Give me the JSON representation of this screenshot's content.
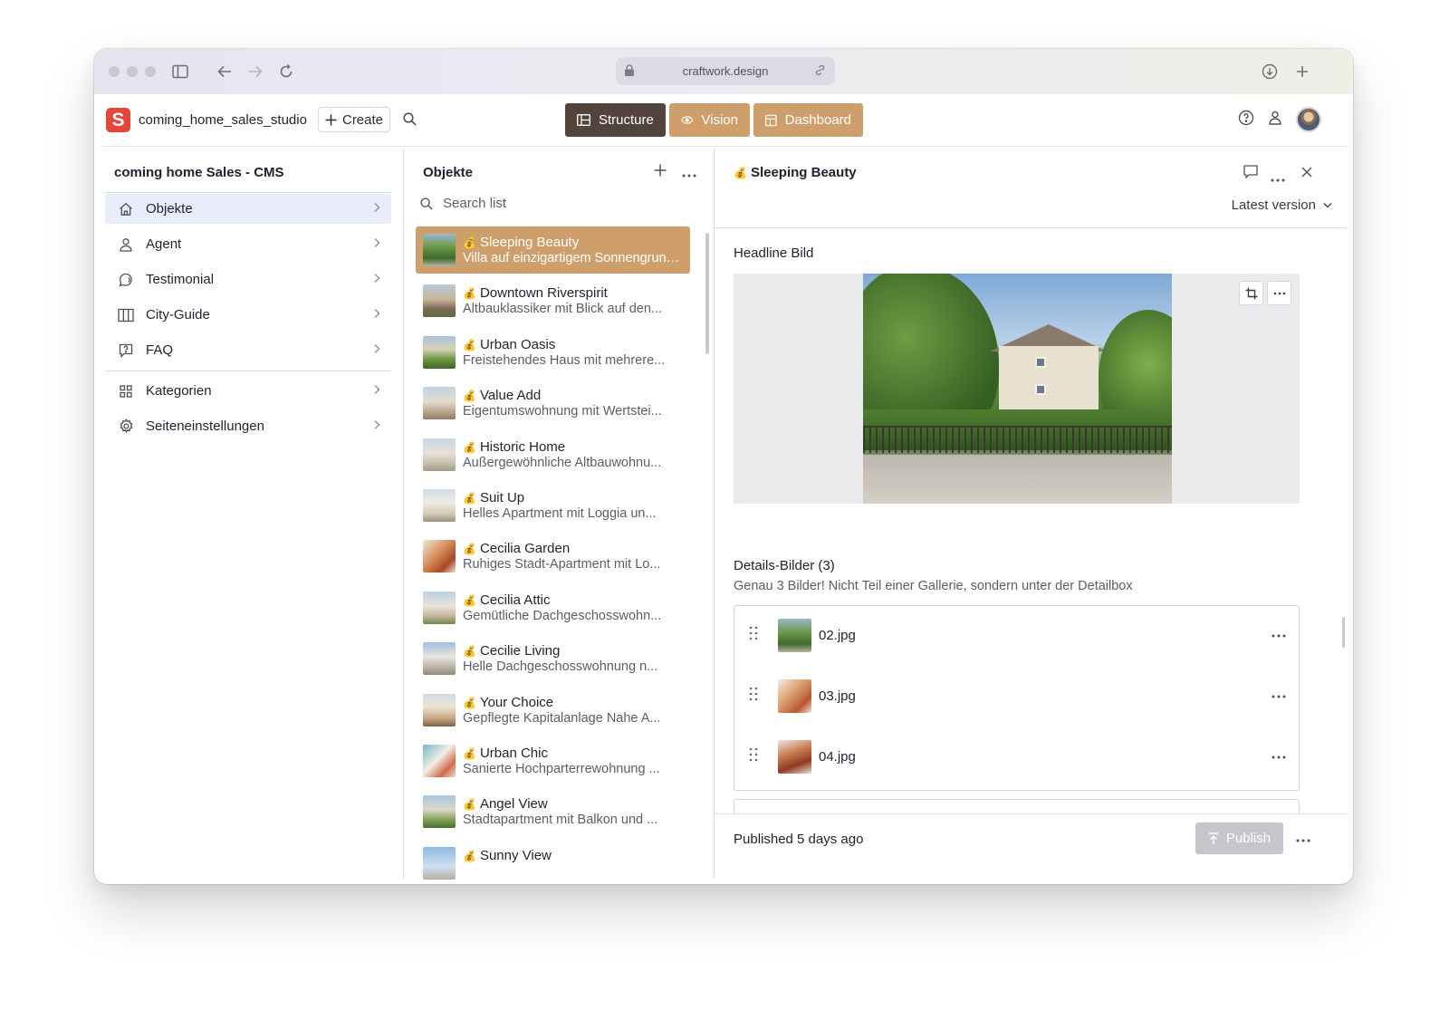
{
  "browser": {
    "url": "craftwork.design"
  },
  "topbar": {
    "logo_letter": "S",
    "workspace": "coming_home_sales_studio",
    "create_label": "Create",
    "tools": [
      {
        "label": "Structure"
      },
      {
        "label": "Vision"
      },
      {
        "label": "Dashboard"
      }
    ],
    "colors": {
      "structure": "#52443a",
      "tool": "#cf9f6b"
    }
  },
  "sidebar": {
    "title": "coming home Sales - CMS",
    "items": [
      {
        "label": "Objekte",
        "icon": "home-icon",
        "active": true
      },
      {
        "label": "Agent",
        "icon": "user-icon"
      },
      {
        "label": "Testimonial",
        "icon": "chat-icon"
      },
      {
        "label": "City-Guide",
        "icon": "map-icon"
      },
      {
        "label": "FAQ",
        "icon": "help-box-icon"
      }
    ],
    "items2": [
      {
        "label": "Kategorien",
        "icon": "grid-icon"
      },
      {
        "label": "Seiteneinstellungen",
        "icon": "gear-icon"
      }
    ]
  },
  "list": {
    "title": "Objekte",
    "search_placeholder": "Search list",
    "items": [
      {
        "title": "Sleeping Beauty",
        "subtitle": "Villa auf einzigartigem Sonnengrundstück",
        "active": true
      },
      {
        "title": "Downtown Riverspirit",
        "subtitle": "Altbauklassiker mit Blick auf den..."
      },
      {
        "title": "Urban Oasis",
        "subtitle": "Freistehendes Haus mit mehrere..."
      },
      {
        "title": "Value Add",
        "subtitle": "Eigentumswohnung mit Wertstei..."
      },
      {
        "title": "Historic Home",
        "subtitle": "Außergewöhnliche Altbauwohnu..."
      },
      {
        "title": "Suit Up",
        "subtitle": "Helles Apartment mit Loggia un..."
      },
      {
        "title": "Cecilia Garden",
        "subtitle": "Ruhiges Stadt-Apartment mit Lo..."
      },
      {
        "title": "Cecilia Attic",
        "subtitle": "Gemütliche Dachgeschosswohn..."
      },
      {
        "title": "Cecilie Living",
        "subtitle": "Helle Dachgeschosswohnung n..."
      },
      {
        "title": "Your Choice",
        "subtitle": "Gepflegte Kapitalanlage Nahe A..."
      },
      {
        "title": "Urban Chic",
        "subtitle": "Sanierte Hochparterrewohnung ..."
      },
      {
        "title": "Angel View",
        "subtitle": "Stadtapartment mit Balkon und ..."
      },
      {
        "title": "Sunny View",
        "subtitle": ""
      }
    ]
  },
  "document": {
    "title": "Sleeping Beauty",
    "version_label": "Latest version",
    "headline_label": "Headline Bild",
    "details_label": "Details-Bilder (3)",
    "details_desc": "Genau 3 Bilder! Nicht Teil einer Gallerie, sondern unter der Detailbox",
    "files": [
      {
        "name": "02.jpg"
      },
      {
        "name": "03.jpg"
      },
      {
        "name": "04.jpg"
      }
    ],
    "status": "Published 5 days ago",
    "publish_label": "Publish"
  }
}
